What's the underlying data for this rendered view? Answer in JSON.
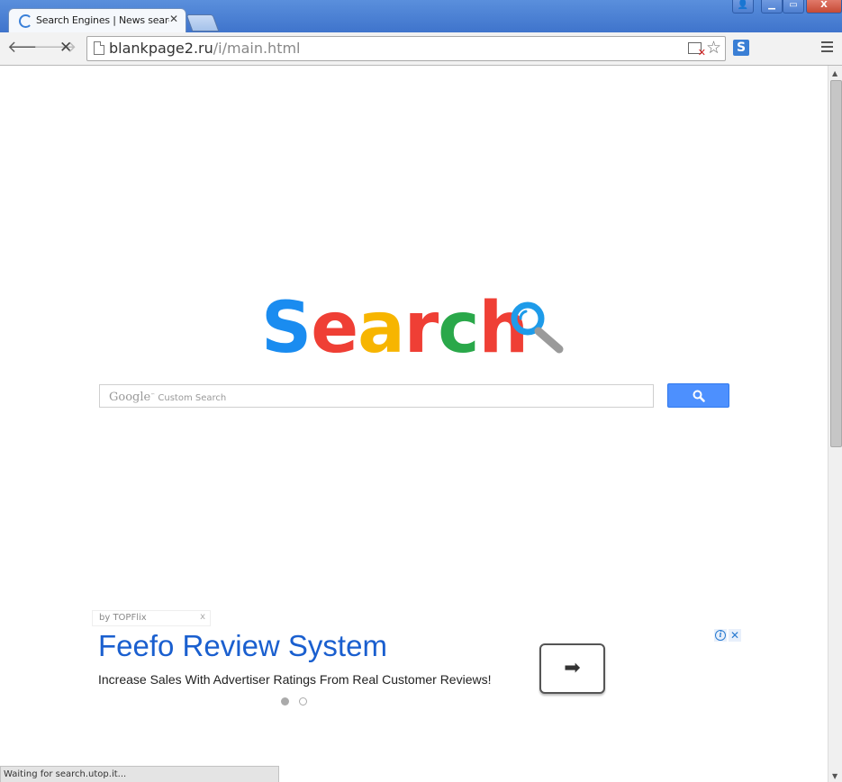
{
  "window": {
    "tab_title": "Search Engines | News searc",
    "tab_close": "✕",
    "controls": {
      "user": "👤",
      "minimize": "▁",
      "maximize": "▭",
      "close": "X"
    }
  },
  "toolbar": {
    "back_icon": "🡐",
    "forward_icon": "🡒",
    "stop_icon": "✕",
    "url_host": "blankpage2.ru",
    "url_path": "/i/main.html",
    "star_icon": "☆",
    "extension_label": "S"
  },
  "main": {
    "logo": {
      "letters": [
        "S",
        "e",
        "a",
        "r",
        "c",
        "h"
      ],
      "colors": [
        "#1a8cf0",
        "#ef3f35",
        "#f7b500",
        "#ef3f35",
        "#2aa84a",
        "#ef3f35"
      ]
    },
    "search": {
      "google_label": "Google",
      "custom_label": "Custom Search",
      "button_color": "#4d90fe"
    }
  },
  "ad": {
    "by_label": "by TOPFlix",
    "by_close": "x",
    "title": "Feefo Review System",
    "description": "Increase Sales With Advertiser Ratings From Real Customer Reviews!",
    "arrow": "➡",
    "info_icon": "i",
    "close_icon": "✕",
    "carousel_active": 1,
    "carousel_count": 2
  },
  "status": {
    "text": "Waiting for search.utop.it..."
  },
  "colors": {
    "accent_blue": "#4d90fe",
    "ad_title": "#1a5fcf",
    "titlebar": "#4a7fd4"
  }
}
